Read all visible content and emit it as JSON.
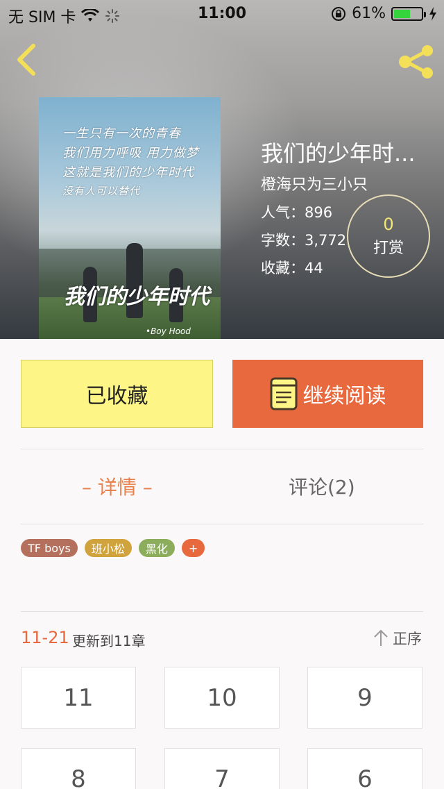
{
  "status_bar": {
    "carrier": "无 SIM 卡",
    "time": "11:00",
    "battery": "61%",
    "battery_level": 0.61
  },
  "header": {
    "back_icon": "chevron-left-icon",
    "share_icon": "share-icon",
    "icon_color": "#f3df58"
  },
  "book": {
    "title": "我们的少年时...",
    "author": "橙海只为三小只",
    "popularity_label": "人气：",
    "popularity": "896",
    "words_label": "字数：",
    "words": "3,772",
    "favorites_label": "收藏：",
    "favorites": "44",
    "cover_lines": [
      "一生只有一次的青春",
      "我们用力呼吸 用力做梦",
      "这就是我们的少年时代",
      "没有人可以替代"
    ],
    "cover_title": "我们的少年时代",
    "cover_subtitle": "•Boy Hood"
  },
  "reward": {
    "count": "0",
    "label": "打赏"
  },
  "actions": {
    "favorited_label": "已收藏",
    "continue_label": "继续阅读",
    "favorited_color": "#fdf686",
    "continue_color": "#e8693e"
  },
  "tabs": {
    "detail": "– 详情 –",
    "comments": "评论(2)"
  },
  "tags": [
    {
      "label": "TF boys",
      "color": "#b5705d"
    },
    {
      "label": "班小松",
      "color": "#d1a33c"
    },
    {
      "label": "黑化",
      "color": "#8cae5c"
    },
    {
      "label": "+",
      "color": "#e8693e"
    }
  ],
  "update": {
    "date": "11-21",
    "text": "更新到11章",
    "order_label": "正序",
    "order_icon": "arrow-up-icon"
  },
  "chapters": [
    "11",
    "10",
    "9",
    "8",
    "7",
    "6"
  ]
}
